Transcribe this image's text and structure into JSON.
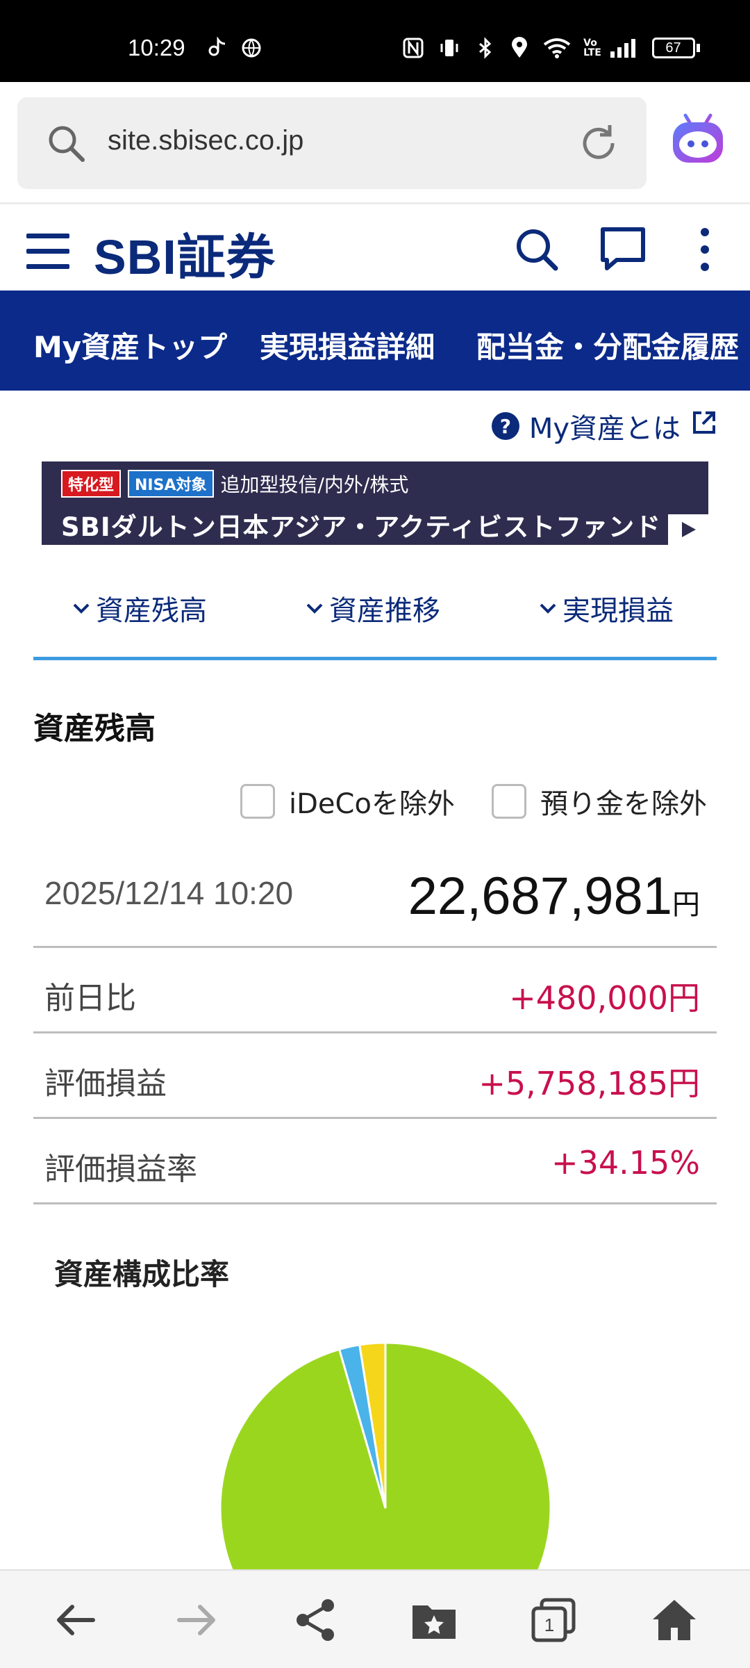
{
  "status_bar": {
    "time": "10:29",
    "battery": "67",
    "icons": [
      "tiktok-icon",
      "globe-icon",
      "nfc-icon",
      "vibrate-icon",
      "bluetooth-icon",
      "location-icon",
      "wifi-icon",
      "volte-icon",
      "signal-icon",
      "battery-icon"
    ]
  },
  "browser": {
    "url": "site.sbisec.co.jp"
  },
  "header": {
    "logo": "SBI証券"
  },
  "nav": {
    "items": [
      "My資産トップ",
      "実現損益詳細",
      "配当金・分配金履歴"
    ]
  },
  "help": {
    "label": "My資産とは"
  },
  "banner": {
    "tag1": "特化型",
    "tag2": "NISA対象",
    "subtitle": "追加型投信/内外/株式",
    "title": "SBIダルトン日本アジア・アクティビストファンド"
  },
  "tabs": [
    "資産残高",
    "資産推移",
    "実現損益"
  ],
  "section": {
    "title": "資産残高",
    "exclude_ideco": "iDeCoを除外",
    "exclude_deposit": "預り金を除外"
  },
  "summary": {
    "datetime": "2025/12/14 10:20",
    "total": "22,687,981",
    "total_unit": "円",
    "rows": [
      {
        "label": "前日比",
        "value": "+480,000円"
      },
      {
        "label": "評価損益",
        "value": "+5,758,185円"
      },
      {
        "label": "評価損益率",
        "value": "+34.15%"
      }
    ]
  },
  "chart": {
    "title": "資産構成比率"
  },
  "chart_data": {
    "type": "pie",
    "values": [
      95.5,
      2.0,
      2.5
    ],
    "colors": [
      "#9bd61f",
      "#4ab3ea",
      "#f6d61b"
    ]
  },
  "colors": {
    "brand": "#0b2a7a",
    "nav": "#0b2a8a",
    "positive": "#c8104c",
    "tab_line": "#3d9be0"
  }
}
